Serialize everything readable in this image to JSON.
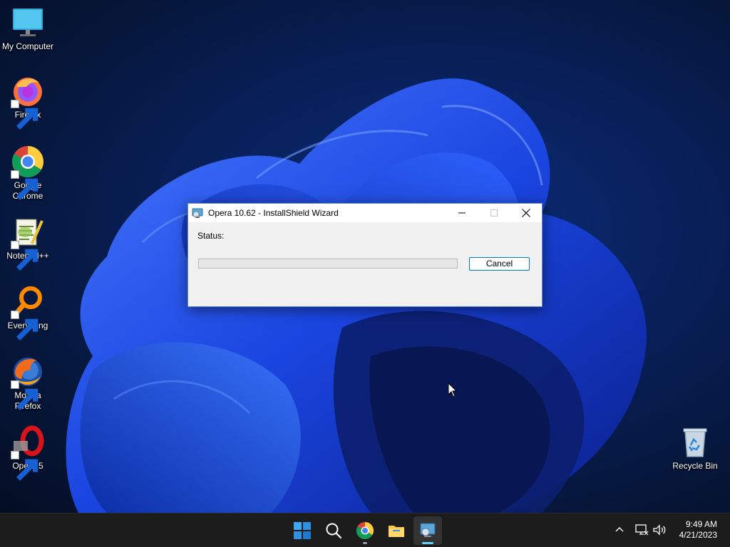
{
  "desktop": {
    "icons": [
      {
        "label": "My Computer",
        "icon": "monitor-icon"
      },
      {
        "label": "Firefox",
        "icon": "firefox-icon"
      },
      {
        "label": "Google Chrome",
        "icon": "chrome-icon"
      },
      {
        "label": "Notepad++",
        "icon": "notepadpp-icon"
      },
      {
        "label": "Everything",
        "icon": "everything-search-icon"
      },
      {
        "label": "Mozilla Firefox",
        "icon": "firefox-old-icon"
      },
      {
        "label": "Opera 5",
        "icon": "opera-icon"
      }
    ],
    "recycle_bin": {
      "label": "Recycle Bin",
      "icon": "recycle-bin-icon"
    }
  },
  "dialog": {
    "title": "Opera 10.62 - InstallShield Wizard",
    "status_label": "Status:",
    "progress": 0,
    "cancel_label": "Cancel",
    "controls": {
      "minimize": "minimize-icon",
      "maximize": "maximize-icon",
      "close": "close-icon"
    }
  },
  "taskbar": {
    "buttons": [
      "start-icon",
      "search-icon",
      "chrome-icon",
      "file-explorer-icon",
      "installer-icon"
    ],
    "tray": [
      "chevron-up-icon",
      "network-icon",
      "volume-icon"
    ],
    "clock": {
      "time": "9:49 AM",
      "date": "4/21/2023"
    }
  },
  "colors": {
    "accent": "#0078d7",
    "taskbar_bg": "#1c1c1c",
    "active_indicator": "#60cdff"
  }
}
